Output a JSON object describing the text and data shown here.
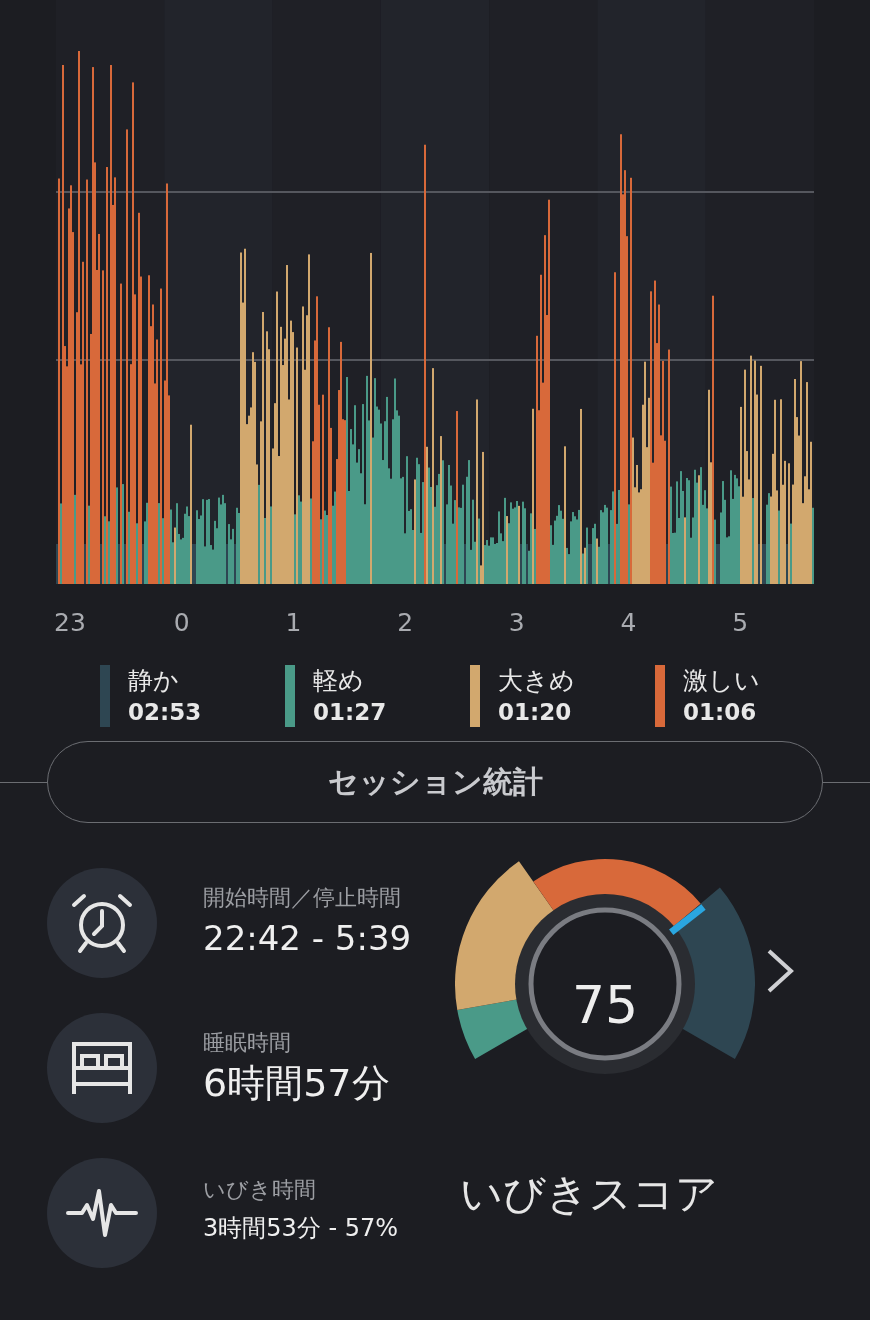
{
  "chart": {
    "x_labels": [
      "23",
      "0",
      "1",
      "2",
      "3",
      "4",
      "5"
    ]
  },
  "legend": [
    {
      "label": "静か",
      "time": "02:53",
      "color": "#2e4652"
    },
    {
      "label": "軽め",
      "time": "01:27",
      "color": "#4a9a88"
    },
    {
      "label": "大きめ",
      "time": "01:20",
      "color": "#d2a86e"
    },
    {
      "label": "激しい",
      "time": "01:06",
      "color": "#d8693a"
    }
  ],
  "section_button": {
    "label": "セッション統計"
  },
  "stats": [
    {
      "kind": "alarm",
      "label": "開始時間／停止時間",
      "value": "22:42 - 5:39"
    },
    {
      "kind": "bed",
      "label": "睡眠時間",
      "value": "6時間57分"
    },
    {
      "kind": "pulse",
      "label": "いびき時間",
      "value": "3時間53分 - 57%"
    }
  ],
  "score": {
    "value": "75",
    "label": "いびきスコア"
  }
}
